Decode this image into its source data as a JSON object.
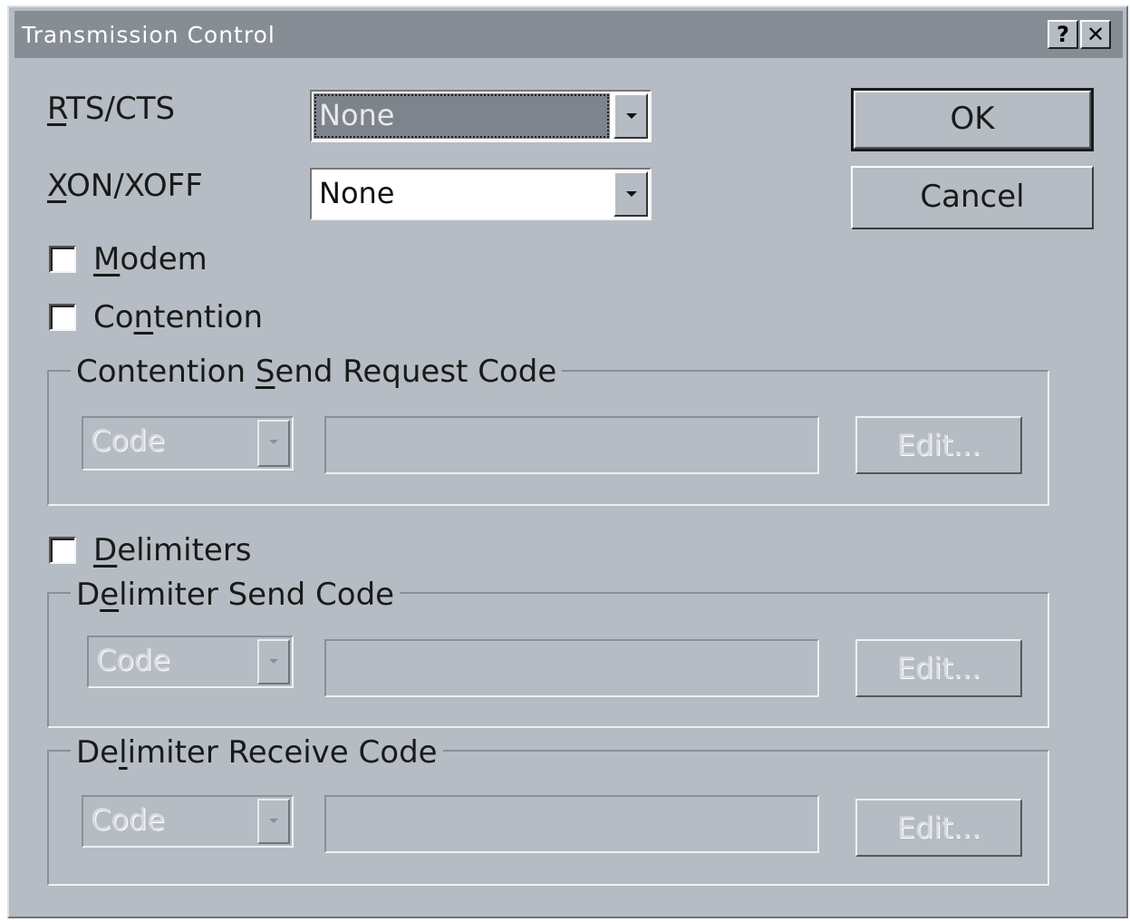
{
  "window": {
    "title": "Transmission Control",
    "help_button": "?",
    "close_button": "✕"
  },
  "rts_cts": {
    "label_pre": "",
    "label_mnemonic": "R",
    "label_post": "TS/CTS",
    "value": "None"
  },
  "xon_xoff": {
    "label_pre": "",
    "label_mnemonic": "X",
    "label_post": "ON/XOFF",
    "value": "None"
  },
  "buttons": {
    "ok": "OK",
    "cancel": "Cancel"
  },
  "modem": {
    "label_pre": "",
    "label_mnemonic": "M",
    "label_post": "odem",
    "checked": false
  },
  "contention": {
    "label_pre": "Co",
    "label_mnemonic": "n",
    "label_post": "tention",
    "checked": false
  },
  "contention_group": {
    "title_pre": "Contention ",
    "title_mnemonic": "S",
    "title_post": "end Request Code",
    "combo_value": "Code",
    "edit_button": "Edit..."
  },
  "delimiters": {
    "label_pre": "",
    "label_mnemonic": "D",
    "label_post": "elimiters",
    "checked": false
  },
  "delimiter_send_group": {
    "title_pre": "D",
    "title_mnemonic": "e",
    "title_post": "limiter Send Code",
    "combo_value": "Code",
    "edit_button": "Edit..."
  },
  "delimiter_receive_group": {
    "title_pre": "De",
    "title_mnemonic": "l",
    "title_post": "imiter Receive Code",
    "combo_value": "Code",
    "edit_button": "Edit..."
  }
}
